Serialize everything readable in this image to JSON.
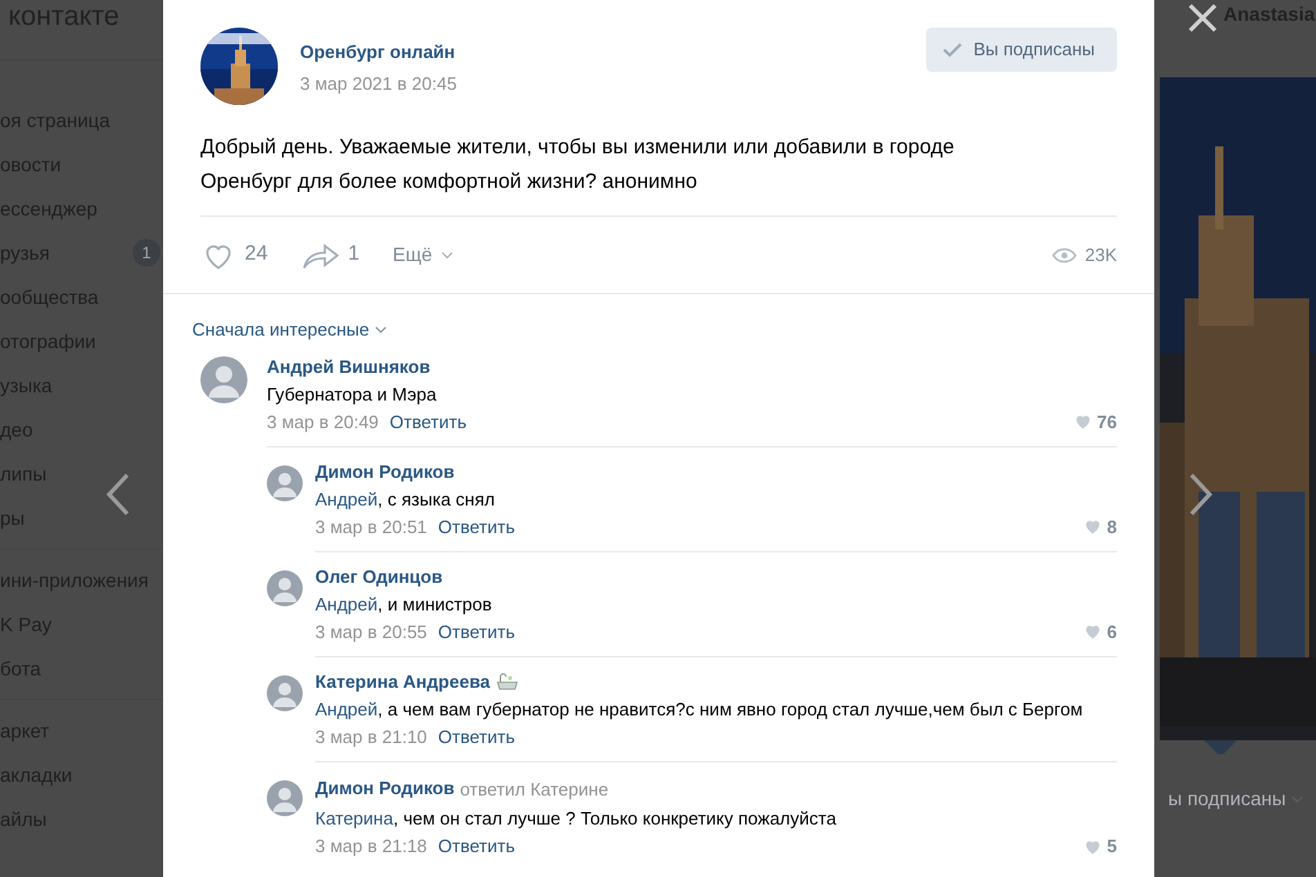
{
  "sidebar": {
    "logo": "контакте",
    "sections": [
      {
        "items": [
          {
            "label": "оя страница"
          },
          {
            "label": "овости"
          },
          {
            "label": "ессенджер"
          },
          {
            "label": "рузья",
            "badge": "1"
          },
          {
            "label": "ообщества"
          },
          {
            "label": "отографии"
          },
          {
            "label": "узыка"
          },
          {
            "label": "део"
          },
          {
            "label": "липы"
          },
          {
            "label": "ры"
          }
        ]
      },
      {
        "items": [
          {
            "label": "ини-приложения"
          },
          {
            "label": "K Pay"
          },
          {
            "label": "бота"
          }
        ]
      },
      {
        "items": [
          {
            "label": "аркет"
          },
          {
            "label": "акладки"
          },
          {
            "label": "айлы"
          }
        ]
      }
    ]
  },
  "top_bar": {
    "user": "Anastasia"
  },
  "post": {
    "author": "Оренбург онлайн",
    "date": "3 мар 2021 в 20:45",
    "subscribe_button": {
      "label": "Вы подписаны",
      "subscribed": true
    },
    "text": "Добрый день. Уважаемые жители, чтобы вы изменили или добавили в городе Оренбург для более комфортной жизни? анонимно",
    "likes": "24",
    "shares": "1",
    "more": "Ещё",
    "views": "23K"
  },
  "comments": {
    "sort": "Сначала интересные",
    "items": [
      {
        "author": "Андрей Вишняков",
        "text": "Губернатора и Мэра",
        "date": "3 мар в 20:49",
        "reply": "Ответить",
        "likes": "76",
        "emoji": false,
        "children": [
          {
            "author": "Димон Родиков",
            "mention": "Андрей",
            "text": ", с языка снял",
            "date": "3 мар в 20:51",
            "reply": "Ответить",
            "likes": "8",
            "emoji": false
          },
          {
            "author": "Олег Одинцов",
            "mention": "Андрей",
            "text": ", и министров",
            "date": "3 мар в 20:55",
            "reply": "Ответить",
            "likes": "6",
            "emoji": false
          },
          {
            "author": "Катерина Андреева",
            "mention": "Андрей",
            "text": ", а чем вам губернатор не нравится?с ним явно город стал лучше,чем был с Бергом",
            "date": "3 мар в 21:10",
            "reply": "Ответить",
            "emoji": true
          },
          {
            "author": "Димон Родиков",
            "replied_to": "ответил Катерине",
            "mention": "Катерина",
            "text": ", чем он стал лучше ? Только конкретику пожалуйста",
            "date": "3 мар в 21:18",
            "reply": "Ответить",
            "likes": "5",
            "emoji": false
          }
        ]
      }
    ]
  },
  "right_panel": {
    "subscribed": "ы подписаны"
  }
}
